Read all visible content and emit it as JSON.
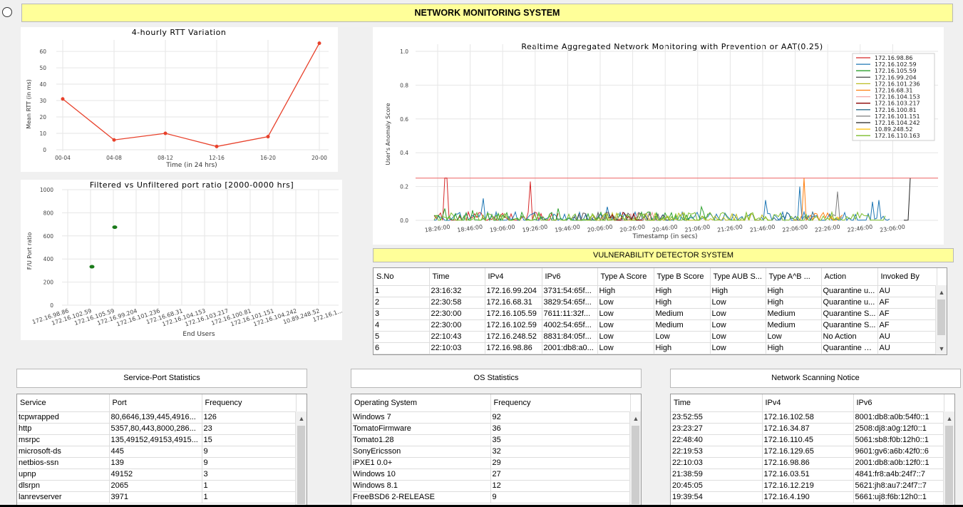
{
  "header": {
    "title": "NETWORK MONITORING SYSTEM"
  },
  "colors": {
    "title_bg": "#ffff99",
    "line_red": "#e8412b",
    "scatter_green": "#1a7a1a"
  },
  "rtt_chart": {
    "chart_data": {
      "type": "line",
      "title": "4-hourly RTT Variation",
      "xlabel": "Time (in 24 hrs)",
      "ylabel": "Mean RTT (in ms)",
      "categories": [
        "00-04",
        "04-08",
        "08-12",
        "12-16",
        "16-20",
        "20-00"
      ],
      "values": [
        31,
        6,
        10,
        2,
        8,
        65
      ],
      "ylim": [
        0,
        67
      ],
      "yticks": [
        "0",
        "10",
        "20",
        "30",
        "40",
        "50",
        "60"
      ],
      "grid": true
    }
  },
  "port_chart": {
    "chart_data": {
      "type": "scatter",
      "title": "Filtered vs Unfiltered port ratio [2000-0000 hrs]",
      "xlabel": "End Users",
      "ylabel": "F/U Port ratio",
      "categories": [
        "172.16.98.86",
        "172.16.102.59",
        "172.16.105.59",
        "172.16.99.204",
        "172.16.101.236",
        "172.16.68.31",
        "172.16.104.153",
        "172.16.103.217",
        "172.16.100.81",
        "172.16.101.151",
        "172.16.104.242",
        "10.89.248.52",
        "172.16.1..."
      ],
      "points": [
        {
          "x": "172.16.102.59",
          "y": 333
        },
        {
          "x": "172.16.105.59",
          "y": 675
        }
      ],
      "ylim": [
        0,
        1000
      ],
      "yticks": [
        "0",
        "200",
        "400",
        "600",
        "800",
        "1000"
      ],
      "grid": true
    }
  },
  "aat_chart": {
    "chart_data": {
      "type": "line",
      "title": "Realtime Aggregated Network Monitoring with Prevention or AAT(0.25)",
      "xlabel": "Timestamp (in secs)",
      "ylabel": "User's Anomaly Score",
      "threshold": 0.25,
      "ylim": [
        0,
        1.0
      ],
      "yticks": [
        "0.0",
        "0.2",
        "0.4",
        "0.6",
        "0.8",
        "1.0"
      ],
      "xticks": [
        "18:26:00",
        "18:46:00",
        "19:06:00",
        "19:26:00",
        "19:46:00",
        "20:06:00",
        "20:26:00",
        "20:46:00",
        "21:06:00",
        "21:26:00",
        "21:46:00",
        "22:06:00",
        "22:26:00",
        "22:46:00",
        "23:06:00"
      ],
      "legend_position": "top-right",
      "series": [
        {
          "name": "172.16.98.86",
          "color": "#d62728"
        },
        {
          "name": "172.16.102.59",
          "color": "#1f77b4"
        },
        {
          "name": "172.16.105.59",
          "color": "#2ca02c"
        },
        {
          "name": "172.16.99.204",
          "color": "#555555"
        },
        {
          "name": "172.16.101.236",
          "color": "#bcbd22"
        },
        {
          "name": "172.16.68.31",
          "color": "#ff7f0e"
        },
        {
          "name": "172.16.104.153",
          "color": "#f4a6a6"
        },
        {
          "name": "172.16.103.217",
          "color": "#8b0000"
        },
        {
          "name": "172.16.100.81",
          "color": "#2f6f8f"
        },
        {
          "name": "172.16.101.151",
          "color": "#7f7f7f"
        },
        {
          "name": "172.16.104.242",
          "color": "#222222"
        },
        {
          "name": "10.89.248.52",
          "color": "#ffbf00"
        },
        {
          "name": "172.16.110.163",
          "color": "#7cbd2c"
        }
      ]
    }
  },
  "vuln": {
    "title": "VULNERABILITY DETECTOR SYSTEM",
    "columns": [
      "S.No",
      "Time",
      "IPv4",
      "IPv6",
      "Type A Score",
      "Type B Score",
      "Type AUB S...",
      "Type A^B ...",
      "Action",
      "Invoked By"
    ],
    "rows": [
      [
        "1",
        "23:16:32",
        "172.16.99.204",
        "3731:54:65f...",
        "High",
        "High",
        "High",
        "High",
        "Quarantine u...",
        "AU"
      ],
      [
        "2",
        "22:30:58",
        "172.16.68.31",
        "3829:54:65f...",
        "Low",
        "High",
        "Low",
        "High",
        "Quarantine u...",
        "AF"
      ],
      [
        "3",
        "22:30:00",
        "172.16.105.59",
        "7611:11:32f...",
        "Low",
        "Medium",
        "Low",
        "Medium",
        "Quarantine S...",
        "AF"
      ],
      [
        "4",
        "22:30:00",
        "172.16.102.59",
        "4002:54:65f...",
        "Low",
        "Medium",
        "Low",
        "Medium",
        "Quarantine S...",
        "AF"
      ],
      [
        "5",
        "22:10:43",
        "172.16.248.52",
        "8831:84:05f...",
        "Low",
        "Low",
        "Low",
        "Low",
        "No Action",
        "AU"
      ],
      [
        "6",
        "22:10:03",
        "172.16.98.86",
        "2001:db8:a0...",
        "Low",
        "High",
        "Low",
        "High",
        "Quarantine U...",
        "AU"
      ]
    ]
  },
  "service_port": {
    "title": "Service-Port Statistics",
    "columns": [
      "Service",
      "Port",
      "Frequency"
    ],
    "rows": [
      [
        "tcpwrapped",
        "80,6646,139,445,4916...",
        "126"
      ],
      [
        "http",
        "5357,80,443,8000,286...",
        "23"
      ],
      [
        "msrpc",
        "135,49152,49153,4915...",
        "15"
      ],
      [
        "microsoft-ds",
        "445",
        "9"
      ],
      [
        "netbios-ssn",
        "139",
        "9"
      ],
      [
        "upnp",
        "49152",
        "3"
      ],
      [
        "dlsrpn",
        "2065",
        "1"
      ],
      [
        "lanrevserver",
        "3971",
        "1"
      ]
    ]
  },
  "os_stats": {
    "title": "OS Statistics",
    "columns": [
      "Operating System",
      "Frequency"
    ],
    "rows": [
      [
        "Windows 7",
        "92"
      ],
      [
        "TomatoFirmware",
        "36"
      ],
      [
        "Tomato1.28",
        "35"
      ],
      [
        "SonyEricsson",
        "32"
      ],
      [
        "iPXE1 0.0+",
        "29"
      ],
      [
        "Windows 10",
        "27"
      ],
      [
        "Windows 8.1",
        "12"
      ],
      [
        "FreeBSD6 2-RELEASE",
        "9"
      ]
    ]
  },
  "scan_notice": {
    "title": "Network Scanning Notice",
    "columns": [
      "Time",
      "IPv4",
      "IPv6"
    ],
    "rows": [
      [
        "23:52:55",
        "172.16.102.58",
        "8001:db8:a0b:54f0::1"
      ],
      [
        "23:23:27",
        "172.16.34.87",
        "2508:dj8:a0g:12f0::1"
      ],
      [
        "22:48:40",
        "172.16.110.45",
        "5061:sb8:f0b:12h0::1"
      ],
      [
        "22:19:53",
        "172.16.129.65",
        "9601:gv6:a6b:42f0::6"
      ],
      [
        "22:10:03",
        "172.16.98.86",
        "2001:db8:a0b:12f0::1"
      ],
      [
        "21:38:59",
        "172.16.03.51",
        "4841:fr8:a4b:24f7::7"
      ],
      [
        "20:45:05",
        "172.16.12.219",
        "5621:jh8:au7:24f7::7"
      ],
      [
        "19:39:54",
        "172.16.4.190",
        "5661:uj8:f6b:12h0::1"
      ]
    ]
  }
}
